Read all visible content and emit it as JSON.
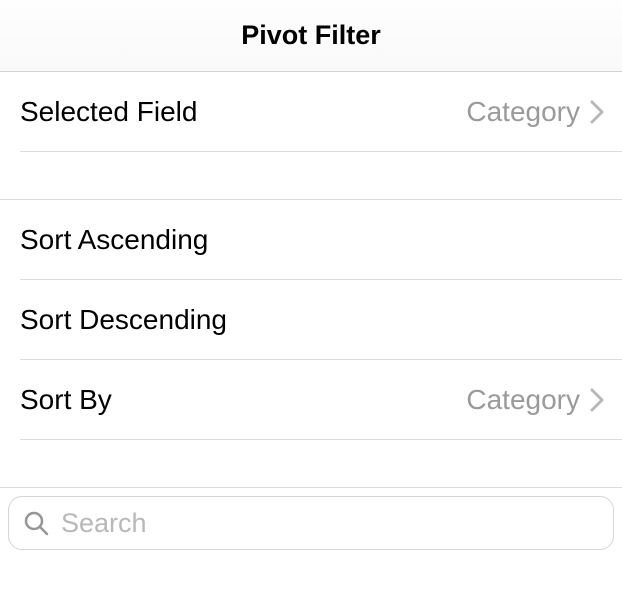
{
  "header": {
    "title": "Pivot Filter"
  },
  "selectedField": {
    "label": "Selected Field",
    "value": "Category"
  },
  "sort": {
    "ascending": "Sort Ascending",
    "descending": "Sort Descending",
    "byLabel": "Sort By",
    "byValue": "Category"
  },
  "search": {
    "placeholder": "Search",
    "value": ""
  }
}
